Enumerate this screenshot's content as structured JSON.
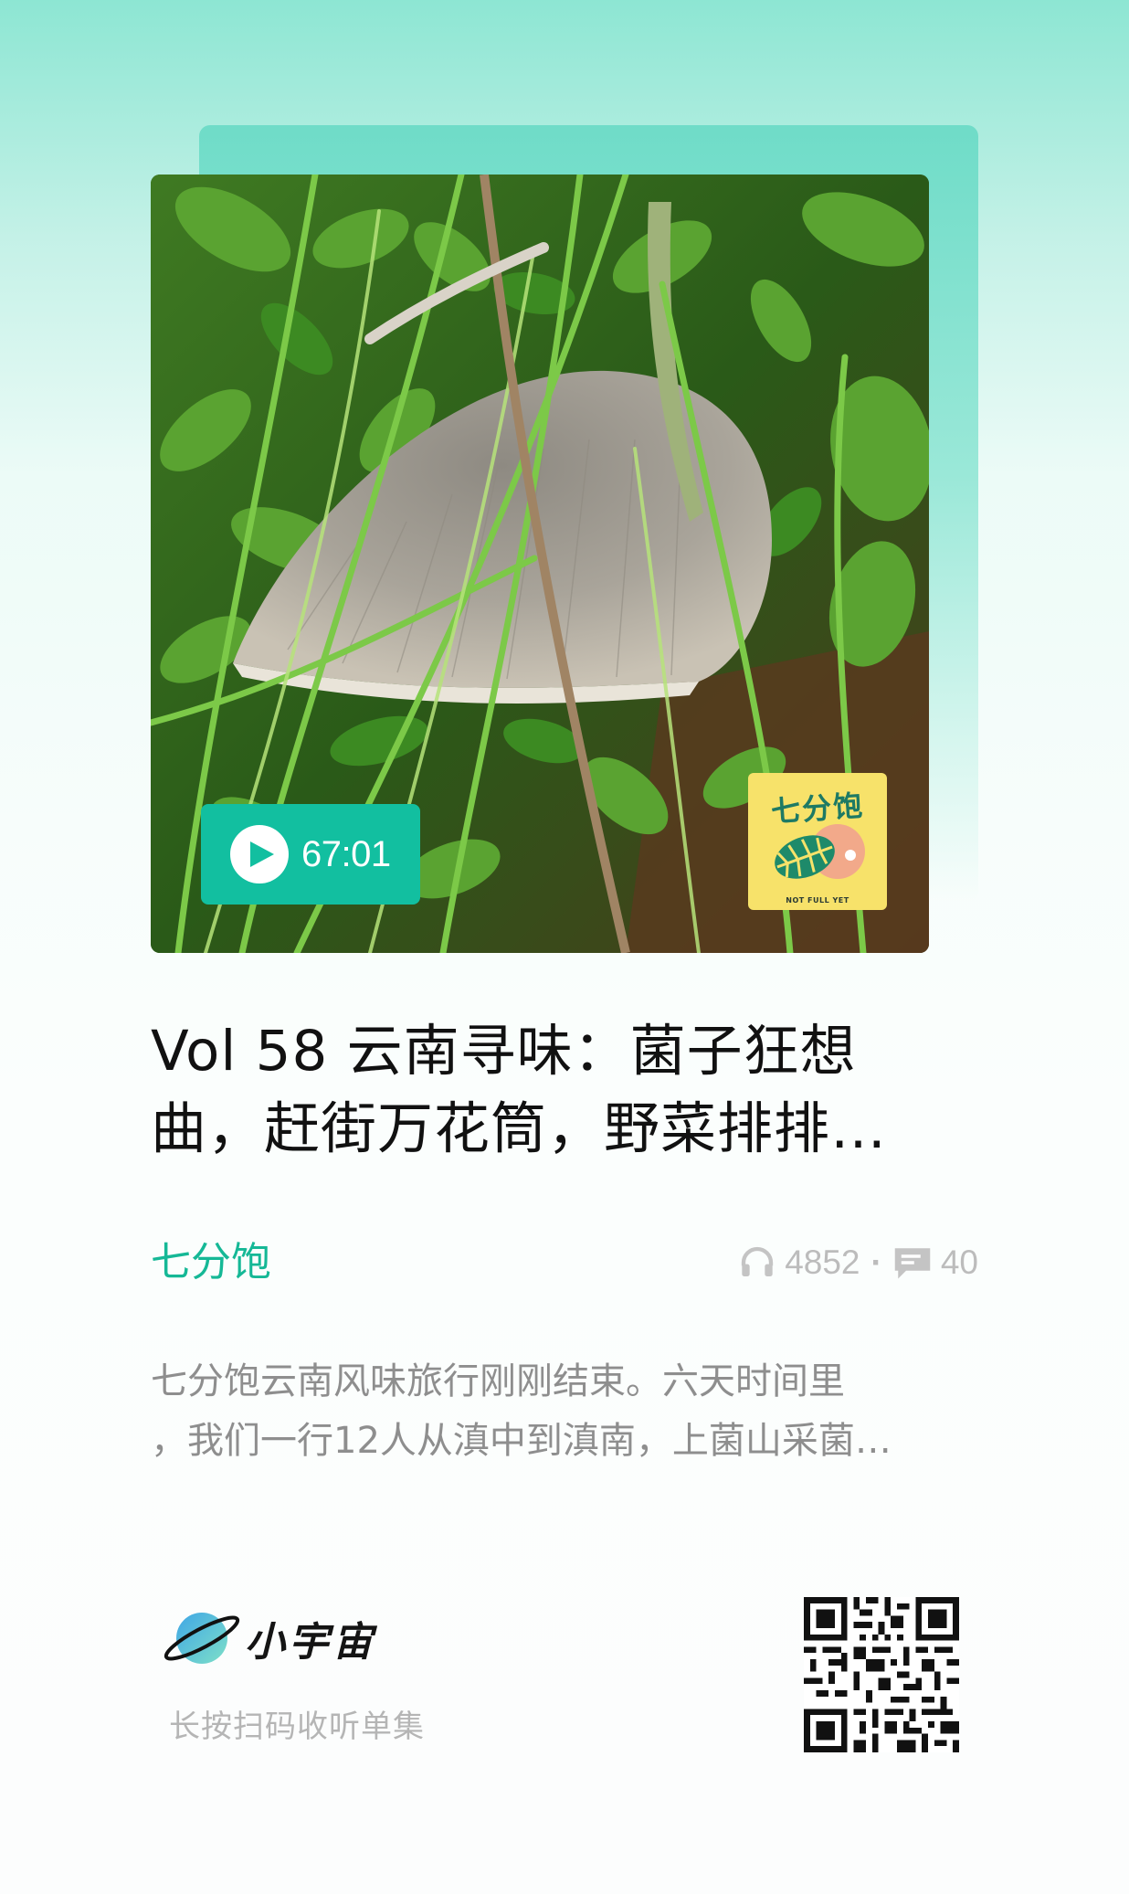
{
  "episode": {
    "duration": "67:01",
    "title": "Vol 58 云南寻味：菌子狂想\n曲，赶街万花筒，野菜排排…",
    "description": "七分饱云南风味旅行刚刚结束。六天时间里\n，我们一行12人从滇中到滇南，上菌山采菌…",
    "cover_icon": "mushroom-photo"
  },
  "show_logo": {
    "title": "七分饱",
    "subtitle": "NOT FULL YET"
  },
  "podcast": {
    "name": "七分饱"
  },
  "stats": {
    "plays": "4852",
    "separator": "·",
    "comments": "40",
    "play_icon": "headphones-icon",
    "comment_icon": "comment-icon"
  },
  "footer": {
    "brand_name": "小宇宙",
    "scan_hint": "长按扫码收听单集"
  },
  "colors": {
    "accent": "#12bfa0",
    "podcast_name": "#15b896",
    "stats": "#bcbcbc",
    "description": "#8e8e8e",
    "title": "#111111"
  }
}
